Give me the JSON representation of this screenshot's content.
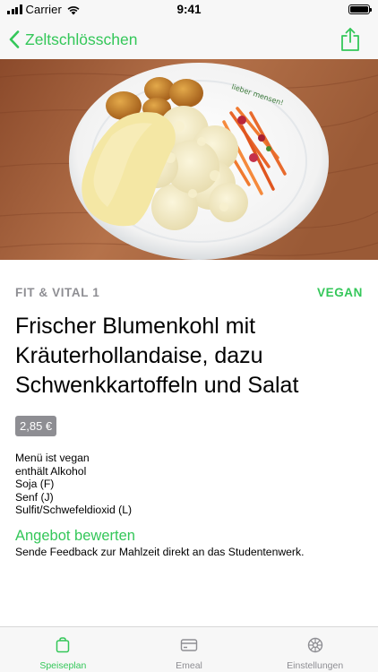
{
  "status_bar": {
    "carrier": "Carrier",
    "time": "9:41"
  },
  "nav": {
    "back_label": "Zeltschlösschen",
    "share_icon": "share-icon"
  },
  "hero": {
    "plate_text": "lieber mensen!"
  },
  "meal": {
    "category": "FIT & VITAL 1",
    "badge": "VEGAN",
    "title": "Frischer Blumenkohl mit Kräuterhollandaise, dazu Schwenkkartoffeln und Salat",
    "price": "2,85 €",
    "info": [
      "Menü ist vegan",
      "enthält Alkohol",
      "Soja (F)",
      "Senf (J)",
      "Sulfit/Schwefeldioxid (L)"
    ]
  },
  "rating": {
    "title": "Angebot bewerten",
    "description": "Sende Feedback zur Mahlzeit direkt an das Studentenwerk."
  },
  "tabs": [
    {
      "label": "Speiseplan",
      "icon": "bag-icon",
      "active": true
    },
    {
      "label": "Emeal",
      "icon": "card-icon",
      "active": false
    },
    {
      "label": "Einstellungen",
      "icon": "gear-icon",
      "active": false
    }
  ],
  "colors": {
    "accent": "#34c759",
    "muted": "#8e8e93",
    "bar_background": "#f7f7f7"
  }
}
